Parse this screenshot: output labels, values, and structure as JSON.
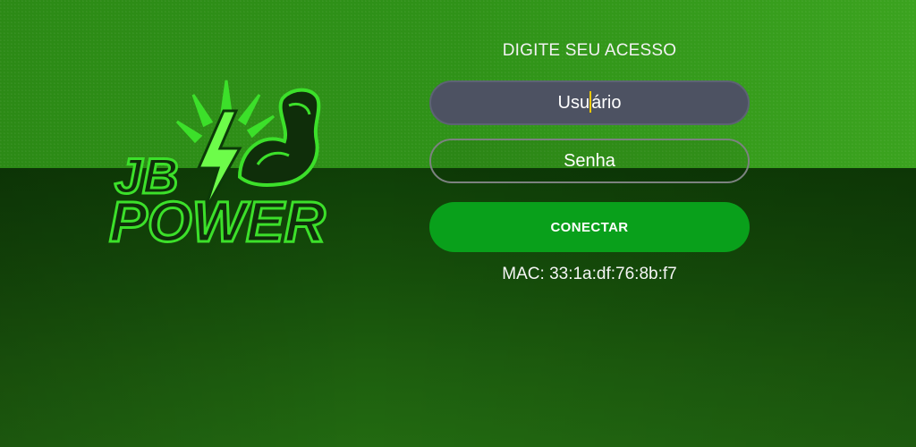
{
  "login": {
    "title": "DIGITE SEU ACESSO",
    "username_text_before_caret": "Usu",
    "username_text_after_caret": "ário",
    "password_placeholder": "Senha",
    "connect_label": "CONECTAR",
    "mac_text": "MAC: 33:1a:df:76:8b:f7"
  },
  "logo": {
    "line1": "JB",
    "line2": "POWER"
  },
  "colors": {
    "background_top": "#2f9218",
    "background_bottom": "#154d0a",
    "button": "#09a01b",
    "input_active": "#4d5262",
    "caret": "#f0c900",
    "logo_green": "#3ce02a"
  }
}
